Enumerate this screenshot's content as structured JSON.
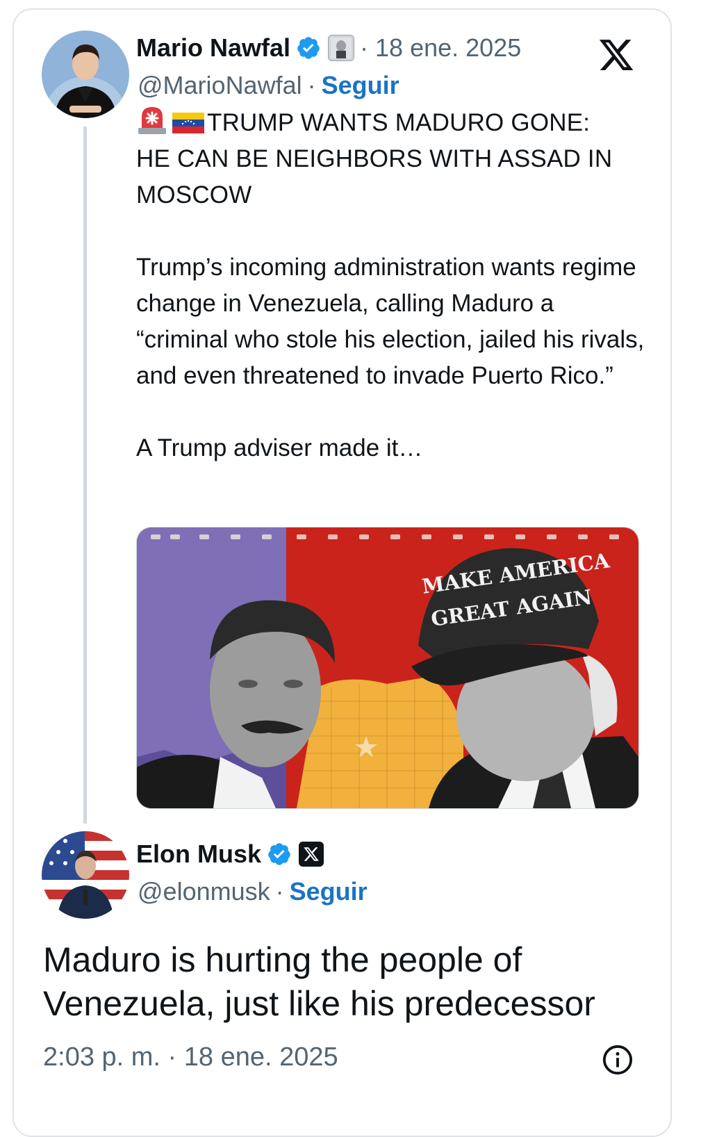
{
  "post": {
    "author_name": "Mario Nawfal",
    "handle": "@MarioNawfal",
    "date": "· 18 ene. 2025",
    "follow_label": "Seguir",
    "emoji": [
      "siren",
      "venezuela-flag"
    ],
    "headline_line1": "TRUMP WANTS MADURO GONE:",
    "headline_rest": "HE CAN BE NEIGHBORS WITH ASSAD IN MOSCOW",
    "paragraph": "Trump’s incoming administration wants regime change in Venezuela, calling Maduro a “criminal who stole his election, jailed his rivals, and even threatened to invade Puerto Rico.”",
    "teaser": "A Trump adviser made it…",
    "image_hat_text_1": "MAKE AMERICA",
    "image_hat_text_2": "GREAT AGAIN"
  },
  "reply": {
    "author_name": "Elon Musk",
    "handle": "@elonmusk",
    "follow_label": "Seguir",
    "text": "Maduro is hurting the people of Venezuela, just like his predecessor",
    "timestamp": "2:03 p. m. · 18 ene. 2025"
  },
  "separator": "·",
  "colors": {
    "follow": "#1a73c7",
    "verified": "#1d9bf0",
    "muted": "#536471"
  },
  "icons": [
    "verified-badge-icon",
    "x-logo-icon",
    "info-icon"
  ]
}
